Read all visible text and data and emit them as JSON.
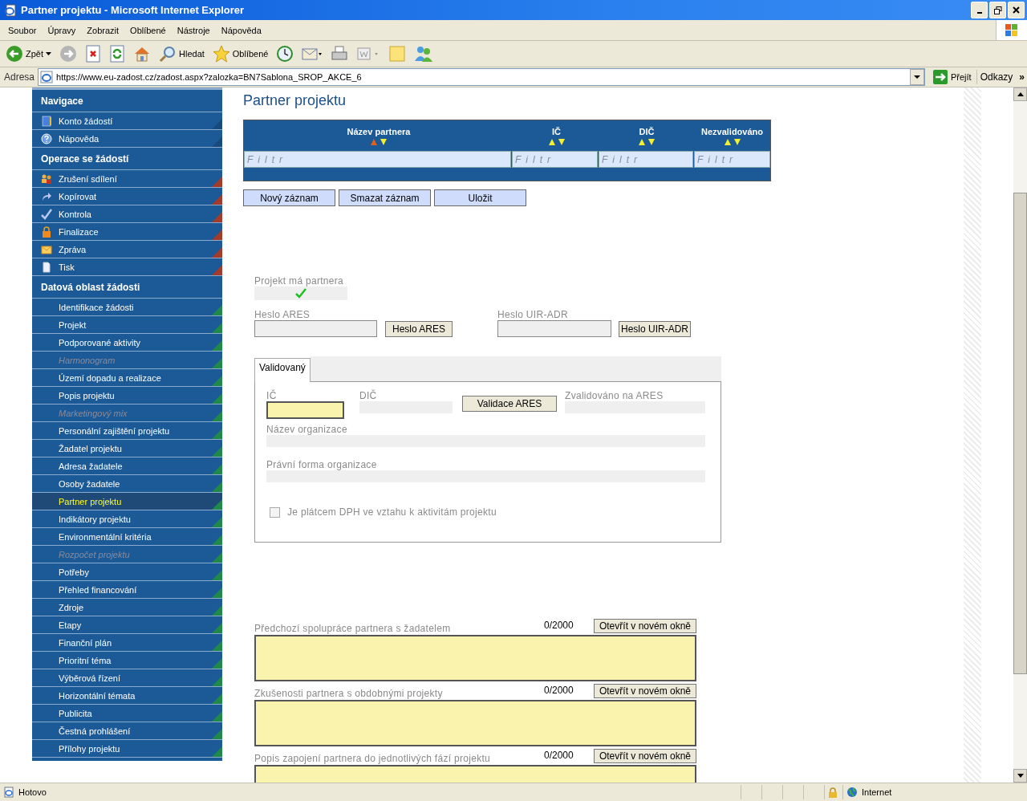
{
  "window": {
    "title": "Partner projektu - Microsoft Internet Explorer"
  },
  "menu": [
    "Soubor",
    "Úpravy",
    "Zobrazit",
    "Oblíbené",
    "Nástroje",
    "Nápověda"
  ],
  "toolbar": [
    {
      "kind": "back",
      "label": "Zpět"
    },
    {
      "kind": "forward"
    },
    {
      "kind": "stop"
    },
    {
      "kind": "refresh"
    },
    {
      "kind": "home"
    },
    {
      "kind": "search",
      "label": "Hledat"
    },
    {
      "kind": "favorites",
      "label": "Oblíbené"
    },
    {
      "kind": "history"
    },
    {
      "kind": "mail"
    },
    {
      "kind": "print"
    },
    {
      "kind": "edit"
    },
    {
      "kind": "note"
    },
    {
      "kind": "messenger"
    }
  ],
  "address": {
    "label": "Adresa",
    "url": "https://www.eu-zadost.cz/zadost.aspx?zalozka=BN7Sablona_SROP_AKCE_6",
    "go": "Přejít",
    "links": "Odkazy",
    "more": "»"
  },
  "sidebar": [
    {
      "title": "Navigace",
      "color": "#174a7c",
      "items": [
        {
          "label": "Konto žádostí",
          "selected": false,
          "disabled": false
        },
        {
          "label": "Nápověda",
          "selected": false,
          "disabled": false
        }
      ]
    },
    {
      "title": "Operace se žádostí",
      "color": "#a33a2a",
      "items": [
        {
          "label": "Zrušení sdílení",
          "selected": false,
          "disabled": false
        },
        {
          "label": "Kopírovat",
          "selected": false,
          "disabled": false
        },
        {
          "label": "Kontrola",
          "selected": false,
          "disabled": false
        },
        {
          "label": "Finalizace",
          "selected": false,
          "disabled": false
        },
        {
          "label": "Zpráva",
          "selected": false,
          "disabled": false
        },
        {
          "label": "Tisk",
          "selected": false,
          "disabled": false
        }
      ]
    },
    {
      "title": "Datová oblast žádosti",
      "color": "#1f8a48",
      "items": [
        {
          "label": "Identifikace žádosti",
          "selected": false,
          "disabled": false
        },
        {
          "label": "Projekt",
          "selected": false,
          "disabled": false
        },
        {
          "label": "Podporované aktivity",
          "selected": false,
          "disabled": false
        },
        {
          "label": "Harmonogram",
          "selected": false,
          "disabled": true
        },
        {
          "label": "Území dopadu a realizace",
          "selected": false,
          "disabled": false
        },
        {
          "label": "Popis projektu",
          "selected": false,
          "disabled": false
        },
        {
          "label": "Marketingový mix",
          "selected": false,
          "disabled": true
        },
        {
          "label": "Personální zajištění projektu",
          "selected": false,
          "disabled": false
        },
        {
          "label": "Žadatel projektu",
          "selected": false,
          "disabled": false
        },
        {
          "label": "Adresa žadatele",
          "selected": false,
          "disabled": false
        },
        {
          "label": "Osoby žadatele",
          "selected": false,
          "disabled": false
        },
        {
          "label": "Partner projektu",
          "selected": true,
          "disabled": false
        },
        {
          "label": "Indikátory projektu",
          "selected": false,
          "disabled": false
        },
        {
          "label": "Environmentální kritéria",
          "selected": false,
          "disabled": false
        },
        {
          "label": "Rozpočet projektu",
          "selected": false,
          "disabled": true
        },
        {
          "label": "Potřeby",
          "selected": false,
          "disabled": false
        },
        {
          "label": "Přehled financování",
          "selected": false,
          "disabled": false
        },
        {
          "label": "Zdroje",
          "selected": false,
          "disabled": false
        },
        {
          "label": "Etapy",
          "selected": false,
          "disabled": false
        },
        {
          "label": "Finanční plán",
          "selected": false,
          "disabled": false
        },
        {
          "label": "Prioritní téma",
          "selected": false,
          "disabled": false
        },
        {
          "label": "Výběrová řízení",
          "selected": false,
          "disabled": false
        },
        {
          "label": "Horizontální témata",
          "selected": false,
          "disabled": false
        },
        {
          "label": "Publicita",
          "selected": false,
          "disabled": false
        },
        {
          "label": "Čestná prohlášení",
          "selected": false,
          "disabled": false
        },
        {
          "label": "Přílohy projektu",
          "selected": false,
          "disabled": false
        }
      ]
    }
  ],
  "heading": "Partner projektu",
  "grid": {
    "columns": [
      {
        "label": "Název partnera",
        "sorted_ascending": true,
        "placeholder": "Filtr"
      },
      {
        "label": "IČ",
        "sorted_ascending": false,
        "placeholder": "Filtr"
      },
      {
        "label": "DIČ",
        "sorted_ascending": false,
        "placeholder": "Filtr"
      },
      {
        "label": "Nezvalidováno",
        "sorted_ascending": false,
        "placeholder": "Filtr"
      }
    ]
  },
  "grid_buttons": [
    "Nový záznam",
    "Smazat záznam",
    "Uložit"
  ],
  "has_partner": {
    "label": "Projekt má partnera",
    "checked": true
  },
  "passwords": [
    {
      "label": "Heslo ARES",
      "button": "Heslo ARES"
    },
    {
      "label": "Heslo UIR-ADR",
      "button": "Heslo UIR-ADR"
    }
  ],
  "tabs": [
    {
      "label": "Validovaný",
      "selected": true
    }
  ],
  "validation": {
    "ic_label": "IČ",
    "dic_label": "DIČ",
    "validate_button": "Validace ARES",
    "validated_label": "Zvalidováno na ARES",
    "name_label": "Název organizace",
    "legal_form_label": "Právní forma organizace",
    "vat": {
      "label": "Je plátcem DPH ve vztahu k aktivitám projektu",
      "checked": false,
      "disabled": true
    }
  },
  "texts": [
    {
      "label": "Předchozí spolupráce partnera s žadatelem",
      "count": "0/2000",
      "button": "Otevřít v novém okně"
    },
    {
      "label": "Zkušenosti partnera s obdobnými projekty",
      "count": "0/2000",
      "button": "Otevřít v novém okně"
    },
    {
      "label": "Popis zapojení partnera do jednotlivých fází projektu",
      "count": "0/2000",
      "button": "Otevřít v novém okně"
    }
  ],
  "status_bar": {
    "text": "Hotovo",
    "zone": "Internet"
  }
}
